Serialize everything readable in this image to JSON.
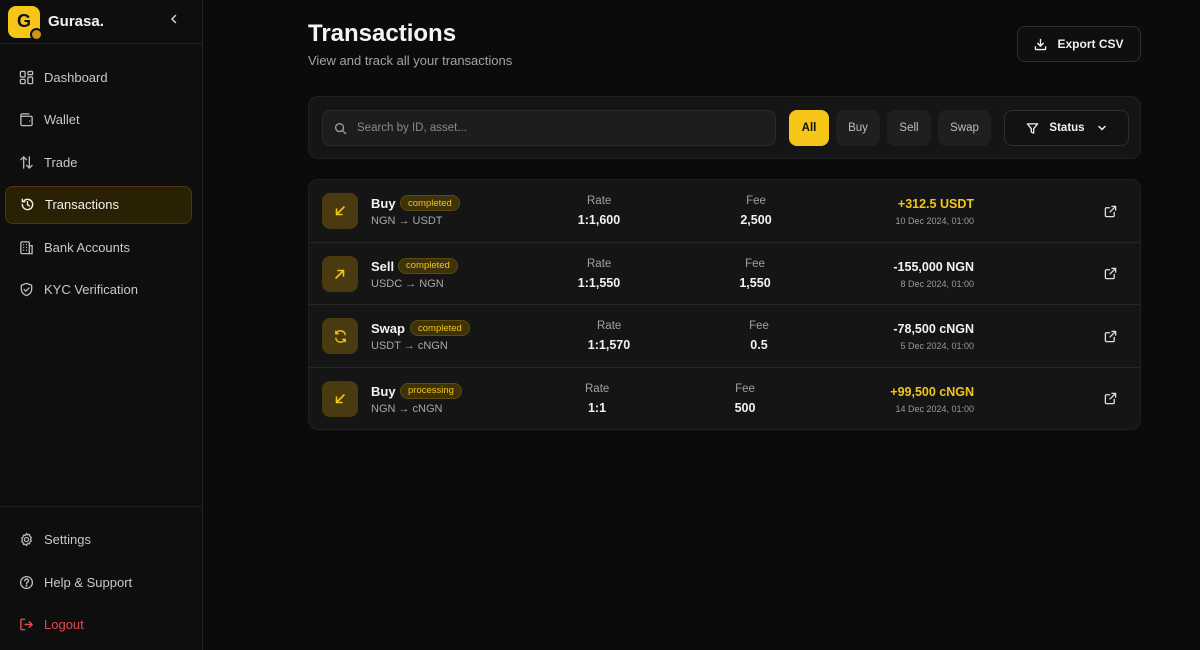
{
  "brand": {
    "letter": "G",
    "name": "Gurasa."
  },
  "sidebar": {
    "items": [
      {
        "label": "Dashboard",
        "icon": "dashboard-icon",
        "active": false
      },
      {
        "label": "Wallet",
        "icon": "wallet-icon",
        "active": false
      },
      {
        "label": "Trade",
        "icon": "trade-arrows-icon",
        "active": false
      },
      {
        "label": "Transactions",
        "icon": "history-icon",
        "active": true
      },
      {
        "label": "Bank Accounts",
        "icon": "bank-icon",
        "active": false
      },
      {
        "label": "KYC Verification",
        "icon": "shield-check-icon",
        "active": false
      }
    ],
    "bottom": [
      {
        "label": "Settings",
        "icon": "gear-icon"
      },
      {
        "label": "Help & Support",
        "icon": "help-icon"
      },
      {
        "label": "Logout",
        "icon": "logout-icon"
      }
    ]
  },
  "header": {
    "title": "Transactions",
    "subtitle": "View and track all your transactions",
    "export_label": "Export CSV"
  },
  "filters": {
    "search_placeholder": "Search by ID, asset...",
    "chips": [
      "All",
      "Buy",
      "Sell",
      "Swap"
    ],
    "active_chip": "All",
    "status_label": "Status"
  },
  "transactions": [
    {
      "type": "Buy",
      "status": "completed",
      "pair": "NGN → USDT",
      "rate_label": "Rate",
      "rate": "1:1,600",
      "fee_label": "Fee",
      "fee": "2,500",
      "amount": "+312.5 USDT",
      "date": "10 Dec 2024, 01:00",
      "direction": "in"
    },
    {
      "type": "Sell",
      "status": "completed",
      "pair": "USDC → NGN",
      "rate_label": "Rate",
      "rate": "1:1,550",
      "fee_label": "Fee",
      "fee": "1,550",
      "amount": "-155,000 NGN",
      "date": "8 Dec 2024, 01:00",
      "direction": "out"
    },
    {
      "type": "Swap",
      "status": "completed",
      "pair": "USDT → cNGN",
      "rate_label": "Rate",
      "rate": "1:1,570",
      "fee_label": "Fee",
      "fee": "0.5",
      "amount": "-78,500 cNGN",
      "date": "5 Dec 2024, 01:00",
      "direction": "swap"
    },
    {
      "type": "Buy",
      "status": "processing",
      "pair": "NGN → cNGN",
      "rate_label": "Rate",
      "rate": "1:1",
      "fee_label": "Fee",
      "fee": "500",
      "amount": "+99,500 cNGN",
      "date": "14 Dec 2024, 01:00",
      "direction": "in"
    }
  ],
  "colors": {
    "accent": "#f5c518",
    "logout": "#e5484d",
    "background": "#0b0b0b"
  }
}
